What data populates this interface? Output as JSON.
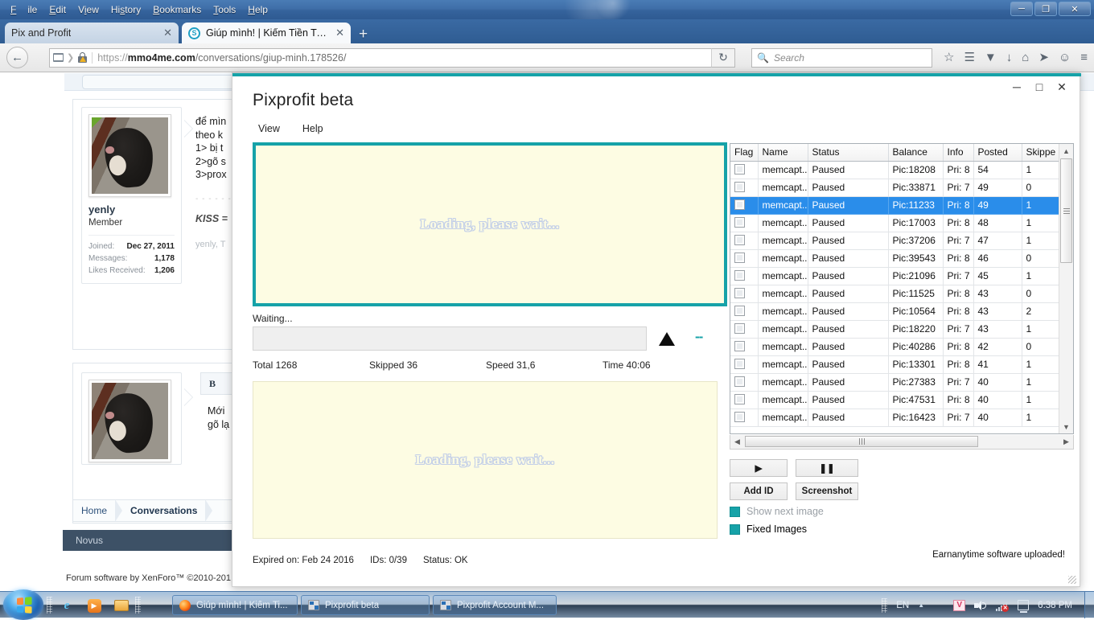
{
  "browser": {
    "menu": [
      "File",
      "Edit",
      "View",
      "History",
      "Bookmarks",
      "Tools",
      "Help"
    ],
    "tabs": [
      {
        "label": "Pix and Profit",
        "active": false,
        "close": "✕"
      },
      {
        "label": "Giúp mình! | Kiếm Tiền Trê...",
        "active": true,
        "close": "✕",
        "favicon": "S"
      }
    ],
    "new_tab": "+",
    "window_buttons": {
      "minimize": "─",
      "restore": "❐",
      "close": "✕"
    },
    "url": {
      "scheme": "https://",
      "host": "mmo4me.com",
      "path": "/conversations/giup-minh.178526/"
    },
    "reload_icon": "↻",
    "back_icon": "←",
    "search": {
      "placeholder": "Search",
      "icon": "⚲"
    },
    "toolbar_icons": [
      "☆",
      "☰",
      "▼",
      "↓",
      "⌂",
      "➤",
      "☺",
      "≡"
    ]
  },
  "page": {
    "author": {
      "name": "yenly",
      "title": "Member",
      "stats": [
        {
          "label": "Joined:",
          "value": "Dec 27, 2011"
        },
        {
          "label": "Messages:",
          "value": "1,178"
        },
        {
          "label": "Likes Received:",
          "value": "1,206"
        }
      ]
    },
    "message_lines": [
      "để mìn",
      "theo k",
      "1> bị t",
      "2>gõ s",
      "3>prox"
    ],
    "kiss_line": "KISS =",
    "sig_line": "yenly, T",
    "editor_bold": "B",
    "reply_lines": [
      "Mới",
      "gõ lạ"
    ],
    "breadcrumb": [
      "Home",
      "Conversations"
    ],
    "novus": "Novus",
    "footer": "Forum software by XenForo™ ©2010-201"
  },
  "app": {
    "title": "Pixprofit beta",
    "menu": [
      "View",
      "Help"
    ],
    "window_buttons": {
      "minimize": "─",
      "maximize": "□",
      "close": "✕"
    },
    "image_panel_text": "Loading, please wait...",
    "image_panel_text2": "Loading, please wait...",
    "waiting_label": "Waiting...",
    "up_arrow_icon": "triangle-up",
    "dashes": "--",
    "stats": [
      {
        "label": "Total 1268"
      },
      {
        "label": "Skipped 36"
      },
      {
        "label": "Speed 31,6"
      },
      {
        "label": "Time 40:06"
      }
    ],
    "table": {
      "columns": [
        "Flag",
        "Name",
        "Status",
        "Balance",
        "Info",
        "Posted",
        "Skippe"
      ],
      "rows": [
        {
          "name": "memcapt...",
          "status": "Paused",
          "balance": "Pic:18208",
          "info": "Pri: 8",
          "posted": "54",
          "skipped": "1",
          "selected": false
        },
        {
          "name": "memcapt...",
          "status": "Paused",
          "balance": "Pic:33871",
          "info": "Pri: 7",
          "posted": "49",
          "skipped": "0",
          "selected": false
        },
        {
          "name": "memcapt...",
          "status": "Paused",
          "balance": "Pic:11233",
          "info": "Pri: 8",
          "posted": "49",
          "skipped": "1",
          "selected": true
        },
        {
          "name": "memcapt...",
          "status": "Paused",
          "balance": "Pic:17003",
          "info": "Pri: 8",
          "posted": "48",
          "skipped": "1",
          "selected": false
        },
        {
          "name": "memcapt...",
          "status": "Paused",
          "balance": "Pic:37206",
          "info": "Pri: 7",
          "posted": "47",
          "skipped": "1",
          "selected": false
        },
        {
          "name": "memcapt...",
          "status": "Paused",
          "balance": "Pic:39543",
          "info": "Pri: 8",
          "posted": "46",
          "skipped": "0",
          "selected": false
        },
        {
          "name": "memcapt...",
          "status": "Paused",
          "balance": "Pic:21096",
          "info": "Pri: 7",
          "posted": "45",
          "skipped": "1",
          "selected": false
        },
        {
          "name": "memcapt...",
          "status": "Paused",
          "balance": "Pic:11525",
          "info": "Pri: 8",
          "posted": "43",
          "skipped": "0",
          "selected": false
        },
        {
          "name": "memcapt...",
          "status": "Paused",
          "balance": "Pic:10564",
          "info": "Pri: 8",
          "posted": "43",
          "skipped": "2",
          "selected": false
        },
        {
          "name": "memcapt...",
          "status": "Paused",
          "balance": "Pic:18220",
          "info": "Pri: 7",
          "posted": "43",
          "skipped": "1",
          "selected": false
        },
        {
          "name": "memcapt...",
          "status": "Paused",
          "balance": "Pic:40286",
          "info": "Pri: 8",
          "posted": "42",
          "skipped": "0",
          "selected": false
        },
        {
          "name": "memcapt...",
          "status": "Paused",
          "balance": "Pic:13301",
          "info": "Pri: 8",
          "posted": "41",
          "skipped": "1",
          "selected": false
        },
        {
          "name": "memcapt...",
          "status": "Paused",
          "balance": "Pic:27383",
          "info": "Pri: 7",
          "posted": "40",
          "skipped": "1",
          "selected": false
        },
        {
          "name": "memcapt...",
          "status": "Paused",
          "balance": "Pic:47531",
          "info": "Pri: 8",
          "posted": "40",
          "skipped": "1",
          "selected": false
        },
        {
          "name": "memcapt...",
          "status": "Paused",
          "balance": "Pic:16423",
          "info": "Pri: 7",
          "posted": "40",
          "skipped": "1",
          "selected": false
        }
      ]
    },
    "buttons": {
      "play": "▶",
      "pause": "❚❚",
      "add_id": "Add ID",
      "screenshot": "Screenshot"
    },
    "checkboxes": [
      {
        "label": "Show next image",
        "checked": true,
        "disabled": true
      },
      {
        "label": "Fixed Images",
        "checked": true,
        "disabled": false
      }
    ],
    "status": [
      "Expired on: Feb 24 2016",
      "IDs: 0/39",
      "Status: OK"
    ],
    "notice": "Earnanytime software uploaded!"
  },
  "taskbar": {
    "quick_launch": [
      "e",
      "▶",
      "🖿"
    ],
    "tasks": [
      {
        "label": "Giúp mình! | Kiếm Ti...",
        "icon": "firefox"
      },
      {
        "label": "Pixprofit beta",
        "icon": "app"
      },
      {
        "label": "Pixprofit Account M...",
        "icon": "app"
      }
    ],
    "tray": {
      "lang": "EN",
      "expand": "▲",
      "v_label": "V",
      "clock": "6:38 PM"
    }
  },
  "colors": {
    "accent_teal": "#16a2a8",
    "selection_blue": "#2a8dea",
    "panel_cream": "#fdfce3",
    "chrome_blue": "#35639c"
  }
}
